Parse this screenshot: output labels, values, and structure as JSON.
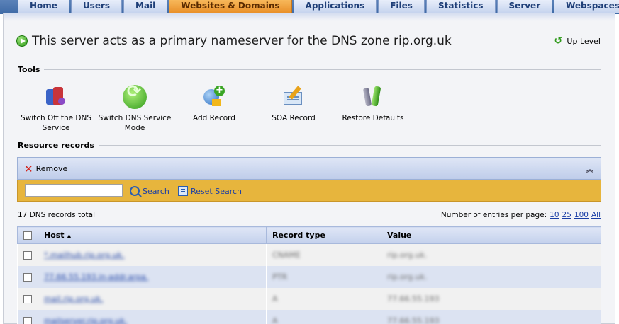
{
  "nav": {
    "tabs": [
      {
        "label": "Home",
        "active": false
      },
      {
        "label": "Users",
        "active": false
      },
      {
        "label": "Mail",
        "active": false
      },
      {
        "label": "Websites & Domains",
        "active": true
      },
      {
        "label": "Applications",
        "active": false
      },
      {
        "label": "Files",
        "active": false
      },
      {
        "label": "Statistics",
        "active": false
      },
      {
        "label": "Server",
        "active": false
      },
      {
        "label": "Webspaces",
        "active": false
      }
    ]
  },
  "header": {
    "title": "This server acts as a primary nameserver for the DNS zone rip.org.uk",
    "up_level": "Up Level"
  },
  "tools": {
    "label": "Tools",
    "items": [
      {
        "label": "Switch Off the DNS Service",
        "icon": "dns-off-icon"
      },
      {
        "label": "Switch DNS Service Mode",
        "icon": "switch-mode-icon"
      },
      {
        "label": "Add Record",
        "icon": "add-record-icon"
      },
      {
        "label": "SOA Record",
        "icon": "soa-record-icon"
      },
      {
        "label": "Restore Defaults",
        "icon": "restore-defaults-icon"
      }
    ]
  },
  "records": {
    "label": "Resource records",
    "remove_label": "Remove",
    "search_value": "",
    "search_label": "Search",
    "reset_label": "Reset Search",
    "total": "17 DNS records total",
    "per_page_label": "Number of entries per page:",
    "per_page_options": [
      "10",
      "25",
      "100",
      "All"
    ],
    "columns": [
      "Host",
      "Record type",
      "Value"
    ],
    "rows": [
      {
        "host": "*.mailhub.rip.org.uk.",
        "type": "CNAME",
        "value": "rip.org.uk."
      },
      {
        "host": "77.66.55.193.in-addr.arpa.",
        "type": "PTR",
        "value": "rip.org.uk."
      },
      {
        "host": "mail.rip.org.uk.",
        "type": "A",
        "value": "77.66.55.193"
      },
      {
        "host": "mailserver.rip.org.uk.",
        "type": "A",
        "value": "77.66.55.193"
      }
    ]
  },
  "colors": {
    "active_tab": "#e9902a",
    "search_bar": "#e7b53d",
    "link": "#1a3ea6"
  }
}
